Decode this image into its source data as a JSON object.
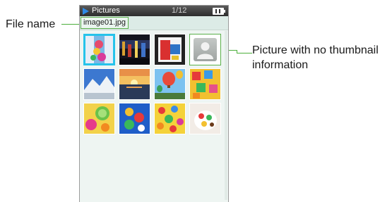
{
  "annotations": {
    "file_name": "File name",
    "no_thumbnail": "Picture with no thumbnail information"
  },
  "app": {
    "title": "Pictures",
    "page_indicator": "1/12",
    "selected_file": "image01.jpg"
  },
  "colors": {
    "selection": "#26c3ea",
    "callout": "#4caf3c",
    "title_bar": "#2c2c2c"
  },
  "icons": [
    "play-icon",
    "battery-icon",
    "person-icon"
  ],
  "thumbnails": [
    {
      "name": "thumb-1",
      "selected": true,
      "has_thumbnail": true
    },
    {
      "name": "thumb-2",
      "selected": false,
      "has_thumbnail": true
    },
    {
      "name": "thumb-3",
      "selected": false,
      "has_thumbnail": true
    },
    {
      "name": "thumb-4",
      "selected": false,
      "has_thumbnail": false
    },
    {
      "name": "thumb-5",
      "selected": false,
      "has_thumbnail": true
    },
    {
      "name": "thumb-6",
      "selected": false,
      "has_thumbnail": true
    },
    {
      "name": "thumb-7",
      "selected": false,
      "has_thumbnail": true
    },
    {
      "name": "thumb-8",
      "selected": false,
      "has_thumbnail": true
    },
    {
      "name": "thumb-9",
      "selected": false,
      "has_thumbnail": true
    },
    {
      "name": "thumb-10",
      "selected": false,
      "has_thumbnail": true
    },
    {
      "name": "thumb-11",
      "selected": false,
      "has_thumbnail": true
    },
    {
      "name": "thumb-12",
      "selected": false,
      "has_thumbnail": true
    }
  ]
}
